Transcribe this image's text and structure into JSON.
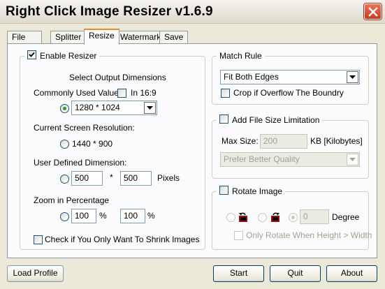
{
  "window": {
    "title": "Right Click Image Resizer v1.6.9"
  },
  "icons": {
    "close": "close-icon",
    "dropdown": "chevron-down-icon",
    "rotate_left": "rotate-left-icon",
    "rotate_right": "rotate-right-icon"
  },
  "colors": {
    "tab_accent": "#e68b2c",
    "radio_selected": "#21a121",
    "close_button": "#c93b1c"
  },
  "tabs": [
    "File Queue",
    "Splitter",
    "Resize",
    "Watermark",
    "Save"
  ],
  "active_tab": "Resize",
  "resizer": {
    "enable_label": "Enable Resizer",
    "enabled": true,
    "select_heading": "Select Output Dimensions",
    "common_label": "Commonly Used Values:",
    "in169_label": "In 16:9",
    "common_value": "1280 * 1024",
    "screen_label": "Current Screen Resolution:",
    "screen_value": "1440 * 900",
    "user_label": "User Defined Dimension:",
    "user_width": "500",
    "times": "*",
    "user_height": "500",
    "pixels_label": "Pixels",
    "zoom_label": "Zoom in Percentage",
    "zoom_w": "100",
    "zoom_h": "100",
    "percent": "%",
    "shrink_label": "Check if You Only Want To Shrink Images"
  },
  "match_rule": {
    "title": "Match Rule",
    "value": "Fit Both Edges",
    "crop_label": "Crop if Overflow The Boundry"
  },
  "file_size": {
    "title": "Add File Size Limitation",
    "max_label": "Max Size:",
    "max_value": "200",
    "unit": "KB [Kilobytes]",
    "quality_value": "Prefer Better Quality"
  },
  "rotate": {
    "title": "Rotate Image",
    "degree_value": "0",
    "degree_label": "Degree",
    "only_label": "Only Rotate When Height > Width"
  },
  "buttons": {
    "load_profile": "Load Profile",
    "start": "Start",
    "quit": "Quit",
    "about": "About"
  }
}
